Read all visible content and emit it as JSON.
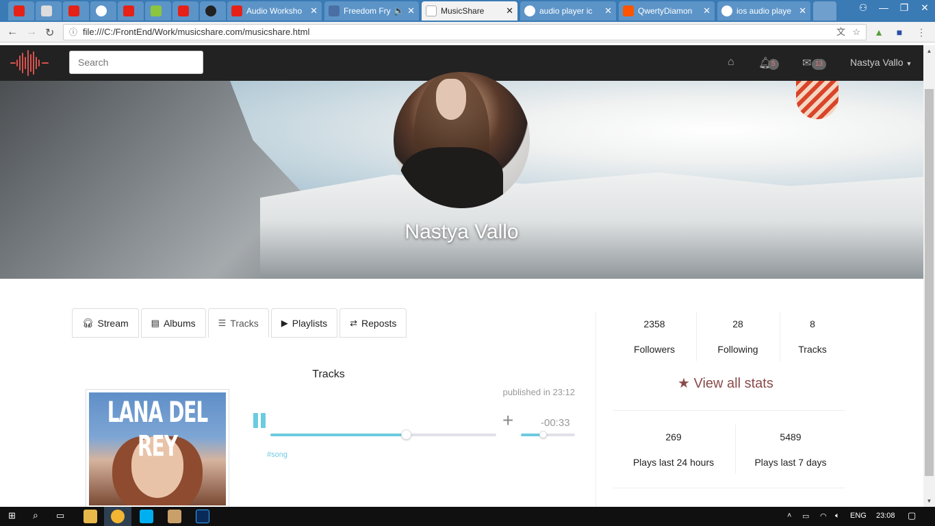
{
  "browser": {
    "tabs": [
      {
        "title": "",
        "icon": "youtube-icon"
      },
      {
        "title": "",
        "icon": "page-icon"
      },
      {
        "title": "",
        "icon": "youtube-icon"
      },
      {
        "title": "",
        "icon": "github-icon"
      },
      {
        "title": "",
        "icon": "youtube-icon"
      },
      {
        "title": "",
        "icon": "w3-icon"
      },
      {
        "title": "",
        "icon": "youtube-icon"
      },
      {
        "title": "",
        "icon": "oc-icon"
      },
      {
        "title": "Audio Worksho",
        "icon": "youtube-icon"
      },
      {
        "title": "Freedom Fry",
        "icon": "play-icon"
      },
      {
        "title": "MusicShare",
        "icon": "page-icon"
      },
      {
        "title": "audio player ic",
        "icon": "google-icon"
      },
      {
        "title": "QwertyDiamon",
        "icon": "soundcloud-icon"
      },
      {
        "title": "ios audio playe",
        "icon": "google-icon"
      }
    ],
    "url": "file:///C:/FrontEnd/Work/musicshare.com/musicshare.html"
  },
  "navbar": {
    "search_placeholder": "Search",
    "notifications_count": "5",
    "messages_count": "13",
    "user_name": "Nastya Vallo"
  },
  "profile": {
    "name": "Nastya Vallo"
  },
  "tabs": {
    "stream": "Stream",
    "albums": "Albums",
    "tracks": "Tracks",
    "playlists": "Playlists",
    "reposts": "Reposts"
  },
  "tracks_section": {
    "title": "Tracks",
    "track": {
      "cover_text": "LANA DEL REY",
      "published": "published in 23:12",
      "time_remaining": "-00:33",
      "progress_fraction": 0.6,
      "volume_fraction": 0.4,
      "tag": "#song"
    }
  },
  "stats": {
    "followers_count": "2358",
    "followers_label": "Followers",
    "following_count": "28",
    "following_label": "Following",
    "tracks_count": "8",
    "tracks_label": "Tracks",
    "view_all": "View all stats",
    "plays_24h_count": "269",
    "plays_24h_label": "Plays last 24 hours",
    "plays_7d_count": "5489",
    "plays_7d_label": "Plays last 7 days"
  },
  "taskbar": {
    "language": "ENG",
    "clock": "23:08"
  },
  "colors": {
    "accent": "#6ccbe0",
    "brand_red": "#d9534f",
    "stat_link": "#8b4a4a",
    "navbar_bg": "#222222"
  }
}
